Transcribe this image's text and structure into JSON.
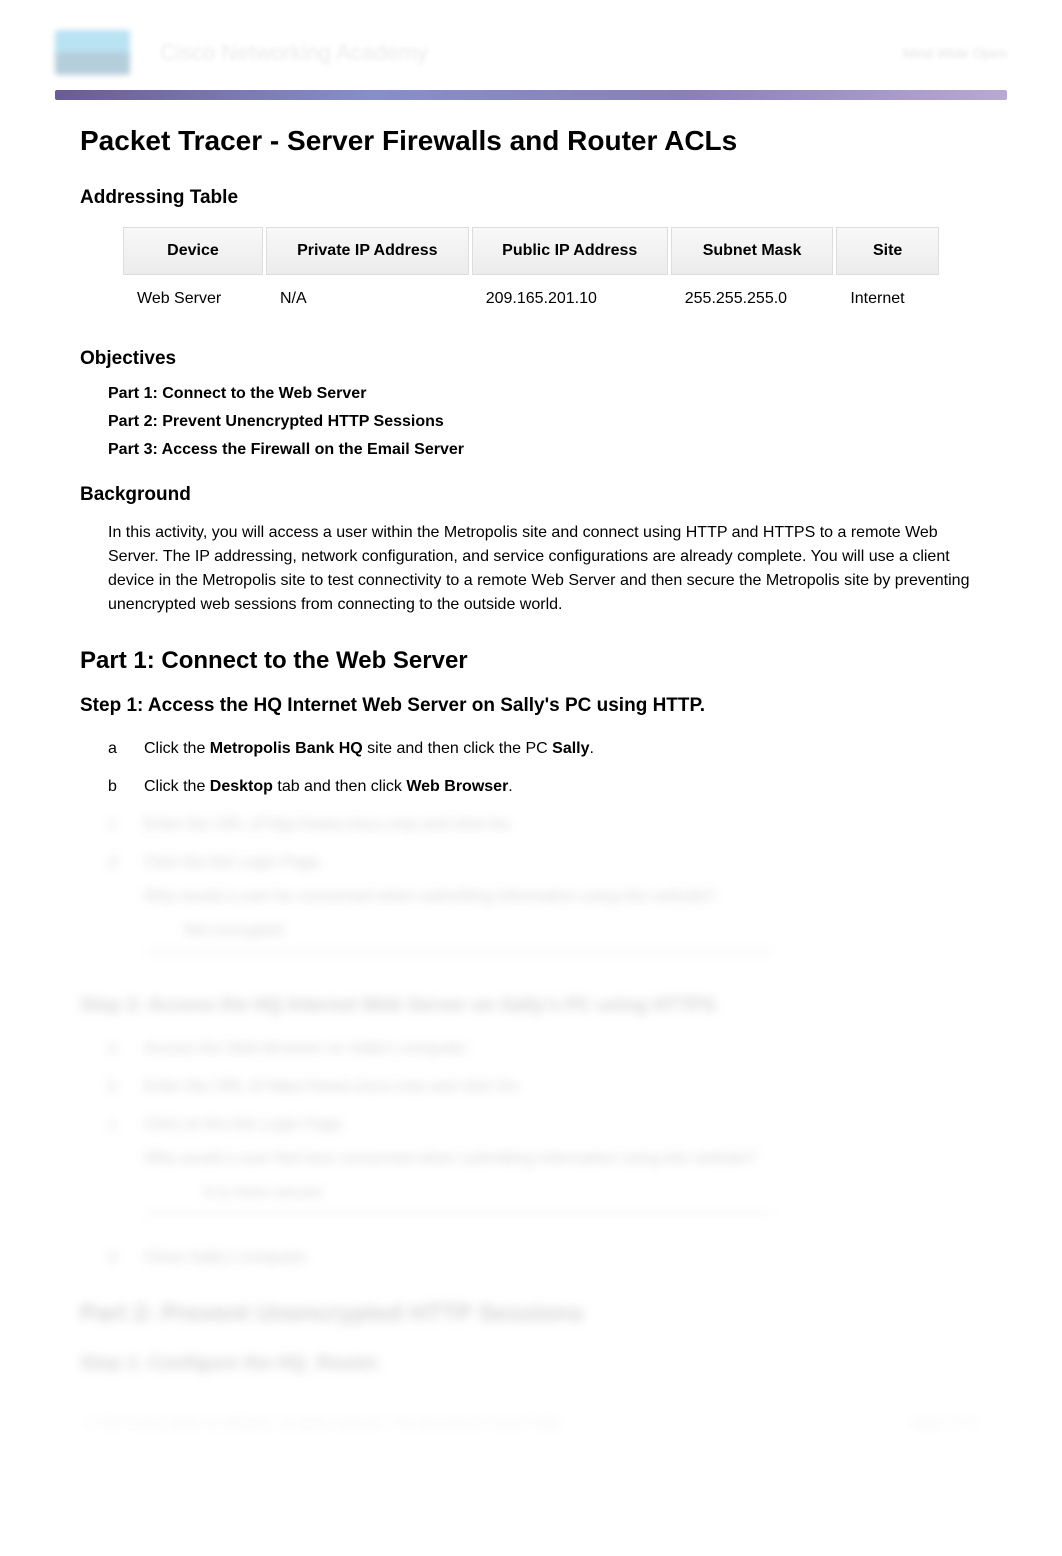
{
  "header": {
    "academy": "Cisco Networking Academy",
    "mind": "Mind Wide Open"
  },
  "title": "Packet Tracer - Server Firewalls and Router ACLs",
  "addressing": {
    "heading": "Addressing Table",
    "columns": [
      "Device",
      "Private IP Address",
      "Public IP Address",
      "Subnet Mask",
      "Site"
    ],
    "rows": [
      {
        "device": "Web Server",
        "private": "N/A",
        "public": "209.165.201.10",
        "mask": "255.255.255.0",
        "site": "Internet"
      }
    ]
  },
  "objectives": {
    "heading": "Objectives",
    "items": [
      "Part 1: Connect to the Web Server",
      "Part 2: Prevent Unencrypted HTTP Sessions",
      "Part 3: Access the Firewall on the Email Server"
    ]
  },
  "background": {
    "heading": "Background",
    "text": "In this activity, you will access a user within the Metropolis site and connect using HTTP and HTTPS to a remote Web Server. The IP addressing, network configuration, and service configurations are already complete. You will use a client device in the Metropolis site to test connectivity to a remote Web Server and then secure the Metropolis site by preventing unencrypted web sessions from connecting to the outside world."
  },
  "part1": {
    "heading": "Part 1: Connect to the Web Server",
    "step1": {
      "heading": "Step 1: Access the HQ Internet Web Server on Sally's PC using HTTP.",
      "items": [
        {
          "letter": "a",
          "pre": "Click the ",
          "b1": "Metropolis Bank HQ",
          "mid": " site and then click the PC ",
          "b2": "Sally",
          "post": "."
        },
        {
          "letter": "b",
          "pre": "Click the ",
          "b1": "Desktop",
          "mid": " tab and then click ",
          "b2": "Web Browser",
          "post": "."
        }
      ]
    }
  },
  "blurred": {
    "c_text": "Enter the URL of http://www.cisco.corp and click Go.",
    "d_text": "Click the link Login Page.",
    "d_q": "Why would a user be concerned when submitting information using this website?",
    "d_ans": "Not encrypted",
    "step2_heading": "Step 2: Access the HQ Internet Web Server on Sally's PC using HTTPS.",
    "s2a": "Access the Web Browser on Sally's computer.",
    "s2b": "Enter the URL of https://www.cisco.corp and click Go.",
    "s2c": "Click on the link Login Page.",
    "s2c_q": "Why would a user feel less concerned when submitting information using this website?",
    "s2c_ans": "It is more secure",
    "s2d": "Close Sally's computer.",
    "part2_heading": "Part 2: Prevent Unencrypted HTTP Sessions",
    "step1b_heading": "Step 1: Configure the HQ_Router.",
    "footer_left": "© 2014 Cisco and/or its affiliates. All rights reserved. This document is Cisco Public.",
    "footer_right": "Page 1 of 2"
  }
}
